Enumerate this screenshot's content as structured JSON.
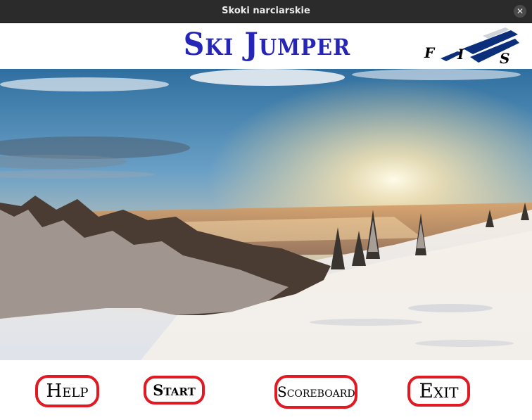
{
  "window": {
    "title": "Skoki narciarskie",
    "close_glyph": "✕"
  },
  "header": {
    "logo_text": "Ski Jumper",
    "logo_color": "#2525b8",
    "fis_logo_text": "FIS"
  },
  "scene": {
    "description_icon": "winter-landscape-image"
  },
  "buttons": {
    "help": "Help",
    "start": "Start",
    "scoreboard": "Scoreboard",
    "exit": "Exit",
    "border_color": "#e01922"
  }
}
